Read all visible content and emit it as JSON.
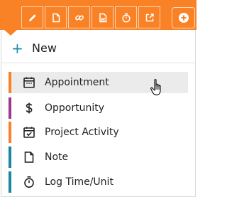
{
  "colors": {
    "brand_orange": "#fa8226",
    "accent_blue": "#1e8ea7",
    "hover_bg": "#ebebeb",
    "bar_purple": "#a0378a",
    "bar_teal": "#17889e"
  },
  "toolbar": {
    "buttons": [
      {
        "icon": "pencil-icon"
      },
      {
        "icon": "document-icon"
      },
      {
        "icon": "link-icon"
      },
      {
        "icon": "word-document-icon"
      },
      {
        "icon": "stopwatch-icon"
      },
      {
        "icon": "external-link-icon"
      }
    ],
    "extra_button_icon": "plus-circle-icon"
  },
  "menu": {
    "new_plus": "+",
    "new_label": "New",
    "items": [
      {
        "label": "Appointment",
        "icon": "calendar-icon",
        "bar_color": "#fa8226",
        "hovered": true
      },
      {
        "label": "Opportunity",
        "icon": "dollar-icon",
        "bar_color": "#a0378a",
        "hovered": false
      },
      {
        "label": "Project Activity",
        "icon": "calendar-check-icon",
        "bar_color": "#fa8226",
        "hovered": false
      },
      {
        "label": "Note",
        "icon": "note-icon",
        "bar_color": "#17889e",
        "hovered": false
      },
      {
        "label": "Log Time/Unit",
        "icon": "stopwatch-icon",
        "bar_color": "#17889e",
        "hovered": false
      }
    ]
  }
}
